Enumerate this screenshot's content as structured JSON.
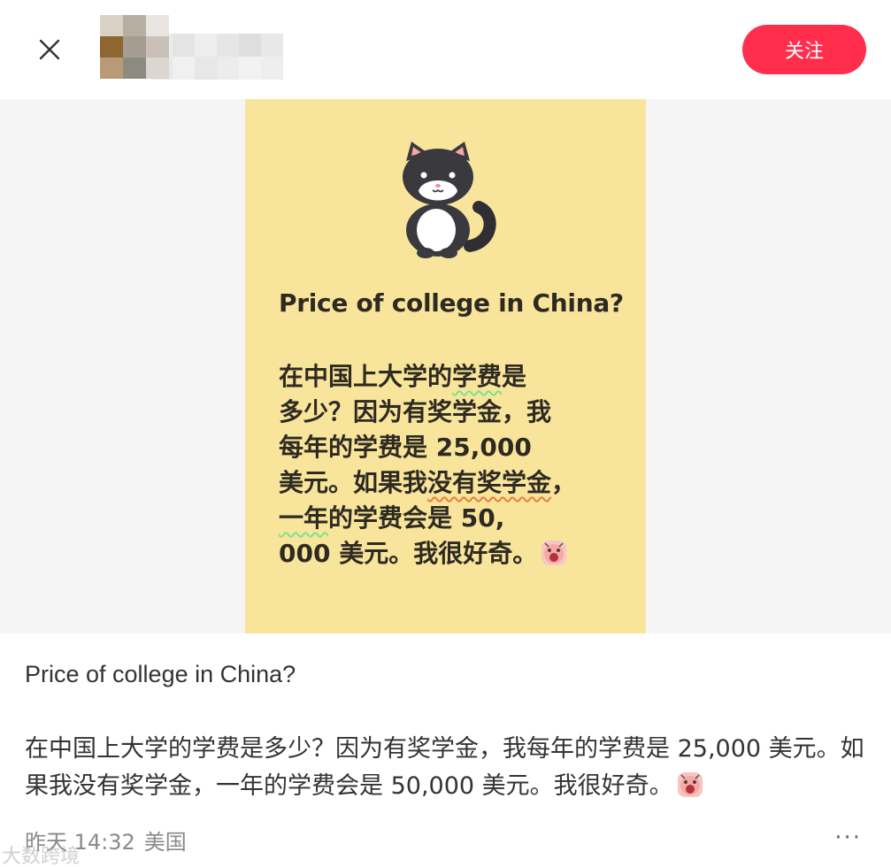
{
  "header": {
    "follow_label": "关注",
    "accent_color": "#ff2e4d",
    "close_icon": "close-icon"
  },
  "poster": {
    "background_color": "#f8e59b",
    "title": "Price of college in China?",
    "lines": [
      "在中国上大学的学费是",
      "多少？因为有奖学金，我",
      "每年的学费是 25,000",
      " 美元。如果我没有奖学金，",
      "一年的学费会是 50,",
      "000 美元。我很好奇。"
    ],
    "mascot_icon": "cat-icon",
    "emoji_icon": "screaming-face-icon"
  },
  "post": {
    "title": "Price of college in China?",
    "body": "在中国上大学的学费是多少？因为有奖学金，我每年的学费是 25,000 美元。如果我没有奖学金，一年的学费会是 50,000 美元。我很好奇。"
  },
  "footer": {
    "time": "昨天 14:32",
    "location": "美国",
    "more_label": "···"
  },
  "watermark": "大数跨境"
}
